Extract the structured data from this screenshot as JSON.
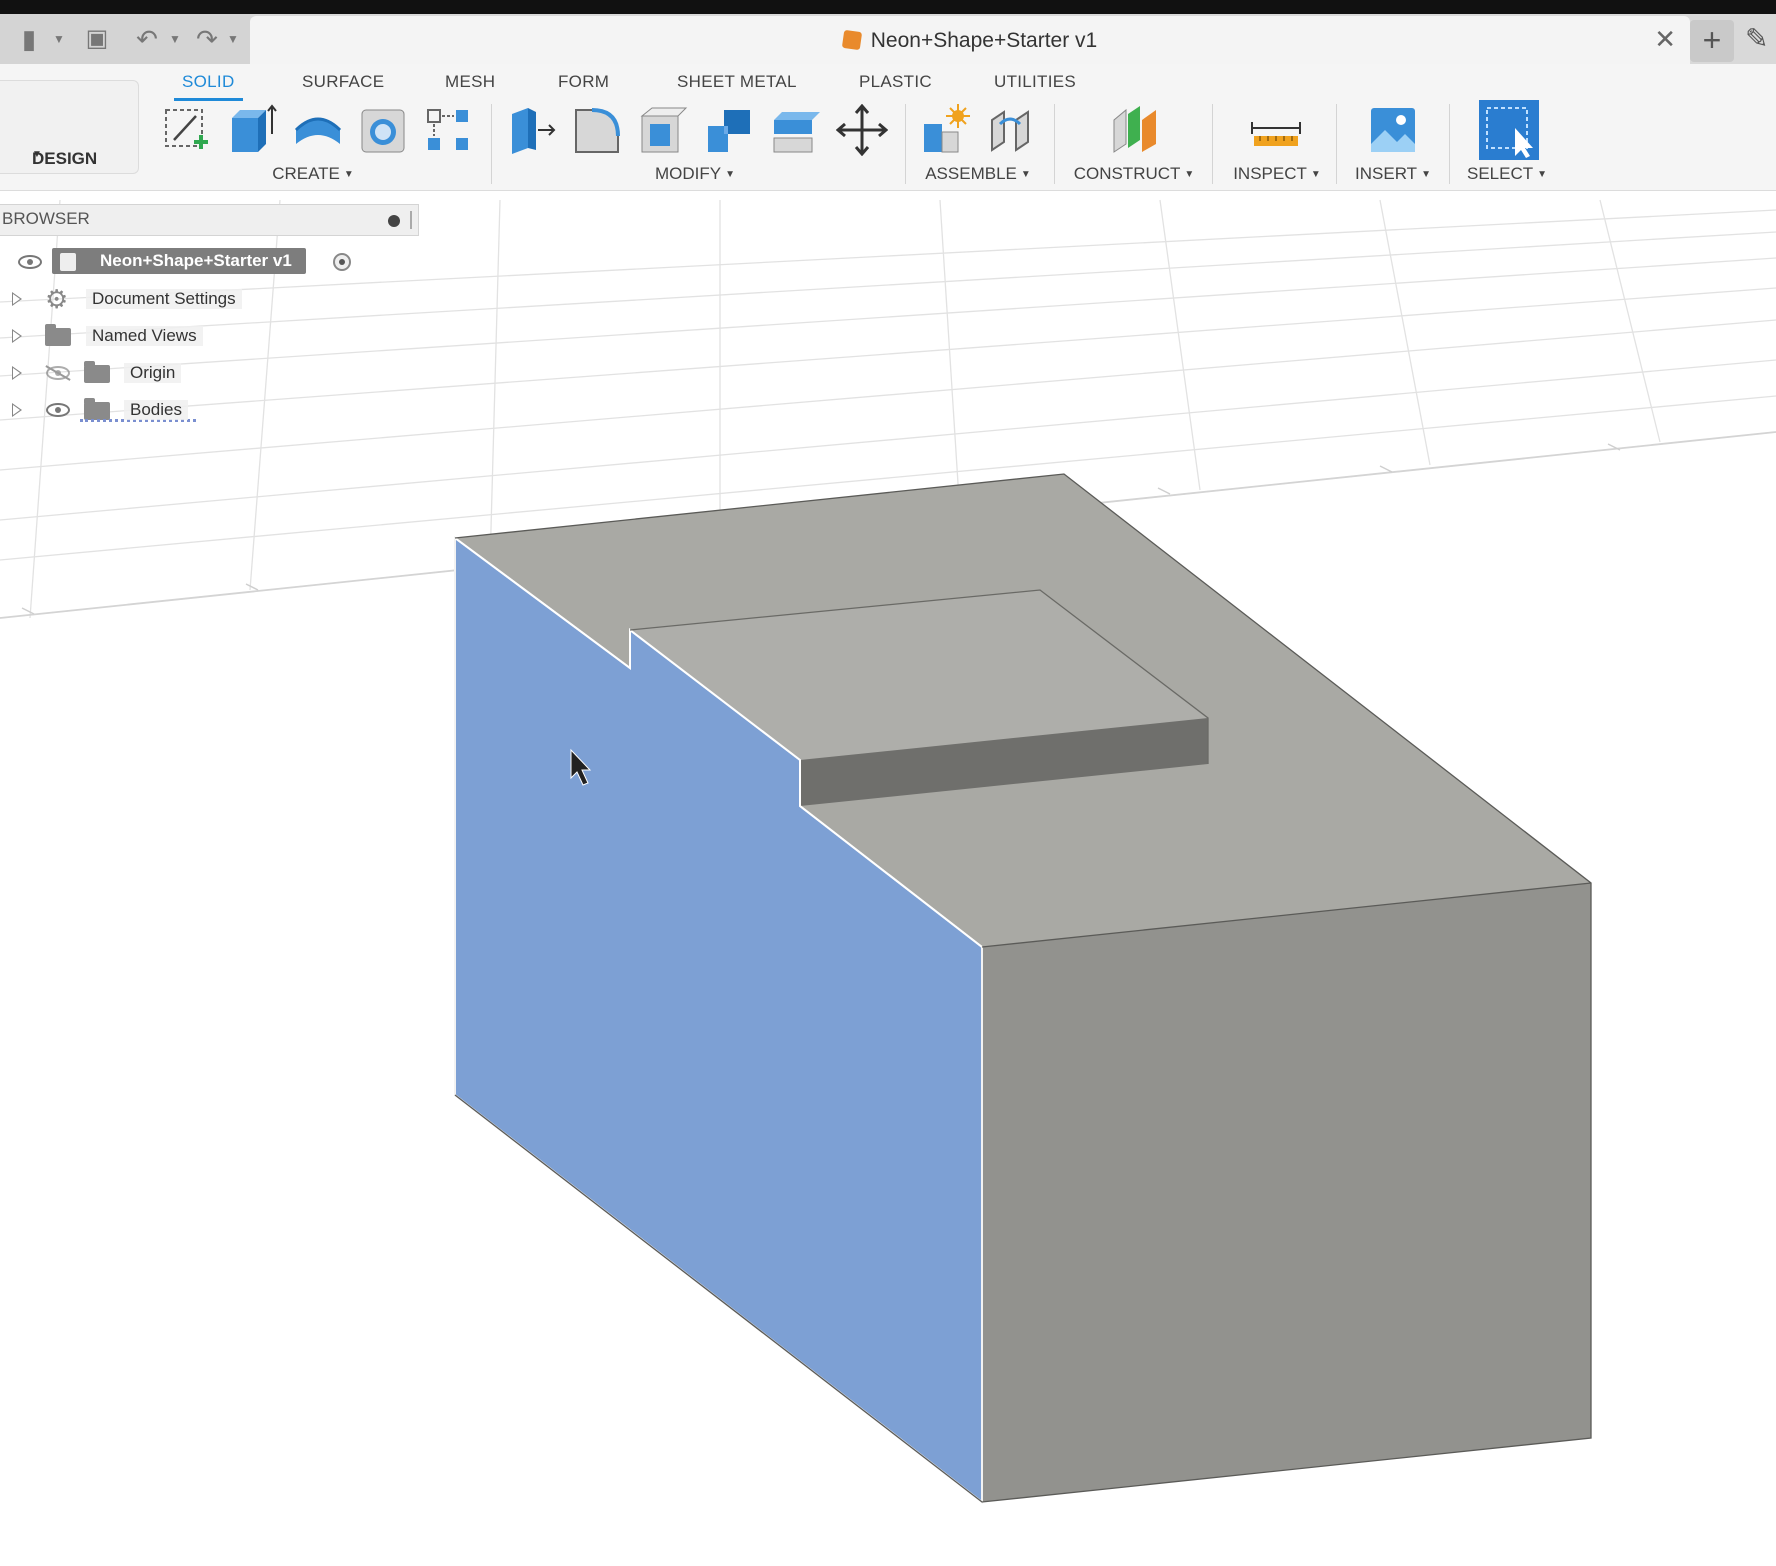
{
  "window": {
    "document_title": "Neon+Shape+Starter v1"
  },
  "quick_access": {
    "icons": [
      "file-icon",
      "save-icon",
      "undo-icon",
      "redo-icon"
    ]
  },
  "workspace": {
    "label": "DESIGN"
  },
  "ribbon": {
    "tabs": [
      {
        "label": "SOLID",
        "active": true
      },
      {
        "label": "SURFACE",
        "active": false
      },
      {
        "label": "MESH",
        "active": false
      },
      {
        "label": "FORM",
        "active": false
      },
      {
        "label": "SHEET METAL",
        "active": false
      },
      {
        "label": "PLASTIC",
        "active": false
      },
      {
        "label": "UTILITIES",
        "active": false
      }
    ],
    "groups": [
      {
        "label": "CREATE"
      },
      {
        "label": "MODIFY"
      },
      {
        "label": "ASSEMBLE"
      },
      {
        "label": "CONSTRUCT"
      },
      {
        "label": "INSPECT"
      },
      {
        "label": "INSERT"
      },
      {
        "label": "SELECT"
      }
    ],
    "accent_color": "#1f8ad8"
  },
  "browser": {
    "title": "BROWSER",
    "items": [
      {
        "label": "Neon+Shape+Starter v1"
      },
      {
        "label": "Document Settings"
      },
      {
        "label": "Named Views"
      },
      {
        "label": "Origin"
      },
      {
        "label": "Bodies"
      }
    ]
  },
  "model": {
    "selected_face_color": "#7da0d4",
    "body_color": "#a8a8a4"
  }
}
